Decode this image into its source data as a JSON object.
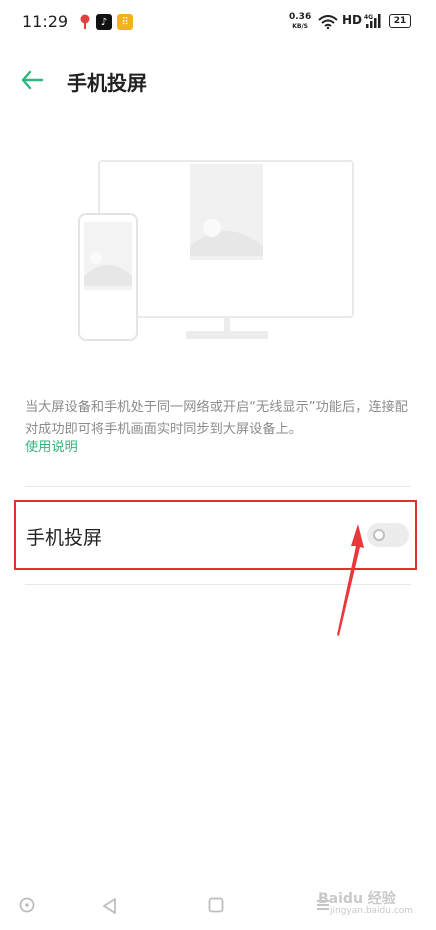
{
  "status_bar": {
    "time": "11:29",
    "net_speed_value": "0.36",
    "net_speed_unit": "KB/S",
    "hd_label": "HD",
    "network_type": "4G",
    "battery": "21"
  },
  "header": {
    "title": "手机投屏"
  },
  "description": {
    "text": "当大屏设备和手机处于同一网络或开启“无线显示”功能后，连接配对成功即可将手机画面实时同步到大屏设备上。",
    "link": "使用说明"
  },
  "setting": {
    "label": "手机投屏",
    "enabled": false
  },
  "watermark": {
    "brand": "Baidu 经验",
    "sub": "jingyan.baidu.com"
  },
  "colors": {
    "accent": "#2fb67b",
    "highlight_box": "#e52e2e",
    "arrow": "#e8383c"
  }
}
